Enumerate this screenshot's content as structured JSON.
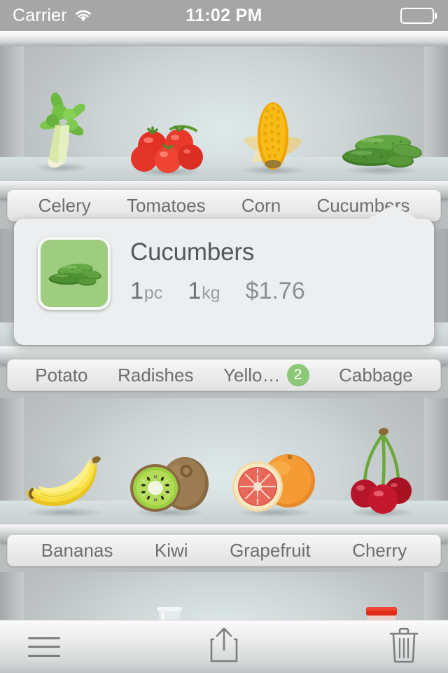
{
  "status_bar": {
    "carrier": "Carrier",
    "wifi_icon": "wifi-icon",
    "time": "11:02 PM",
    "battery_icon": "battery-icon"
  },
  "shelves": [
    {
      "name": "top-shelf",
      "items": [
        {
          "name": "Celery",
          "icon": "celery-icon"
        },
        {
          "name": "Tomatoes",
          "icon": "tomatoes-icon"
        },
        {
          "name": "Corn",
          "icon": "corn-icon"
        },
        {
          "name": "Cucumbers",
          "icon": "cucumbers-icon"
        }
      ],
      "labels": [
        {
          "text": "Celery",
          "badge": ""
        },
        {
          "text": "Tomatoes",
          "badge": ""
        },
        {
          "text": "Corn",
          "badge": ""
        },
        {
          "text": "Cucumbers",
          "badge": ""
        }
      ]
    },
    {
      "name": "second-shelf",
      "items": [
        {
          "name": "Potato",
          "icon": "potato-icon"
        },
        {
          "name": "Radishes",
          "icon": "radishes-icon"
        },
        {
          "name": "Yellow melon",
          "icon": "melon-icon"
        },
        {
          "name": "Cabbage",
          "icon": "cabbage-icon"
        }
      ],
      "labels": [
        {
          "text": "Potato",
          "badge": ""
        },
        {
          "text": "Radishes",
          "badge": ""
        },
        {
          "text": "Yello…",
          "badge": "2"
        },
        {
          "text": "Cabbage",
          "badge": ""
        }
      ]
    },
    {
      "name": "third-shelf",
      "items": [
        {
          "name": "Bananas",
          "icon": "bananas-icon"
        },
        {
          "name": "Kiwi",
          "icon": "kiwi-icon"
        },
        {
          "name": "Grapefruit",
          "icon": "grapefruit-icon"
        },
        {
          "name": "Cherry",
          "icon": "cherry-icon"
        }
      ],
      "labels": [
        {
          "text": "Bananas",
          "badge": ""
        },
        {
          "text": "Kiwi",
          "badge": ""
        },
        {
          "text": "Grapefruit",
          "badge": ""
        },
        {
          "text": "Cherry",
          "badge": ""
        }
      ]
    },
    {
      "name": "bottom-shelf",
      "items": [
        {
          "name": "Glass jar",
          "icon": "glass-jar-icon"
        },
        {
          "name": "Red cap jar",
          "icon": "red-jar-icon"
        }
      ],
      "labels": []
    }
  ],
  "popover": {
    "thumbnail_icon": "cucumbers-thumbnail",
    "thumbnail_color": "#9fcd7f",
    "title": "Cucumbers",
    "quantity_value": "1",
    "quantity_unit": "pc",
    "weight_value": "1",
    "weight_unit": "kg",
    "price": "$1.76"
  },
  "toolbar": {
    "menu_icon": "hamburger-menu-icon",
    "share_icon": "share-icon",
    "trash_icon": "trash-icon"
  },
  "colors": {
    "badge_green": "#8cc878",
    "status_bar": "#a6a6a6",
    "label_text": "#6e6e6e",
    "popover_bg": "#eceef0"
  }
}
